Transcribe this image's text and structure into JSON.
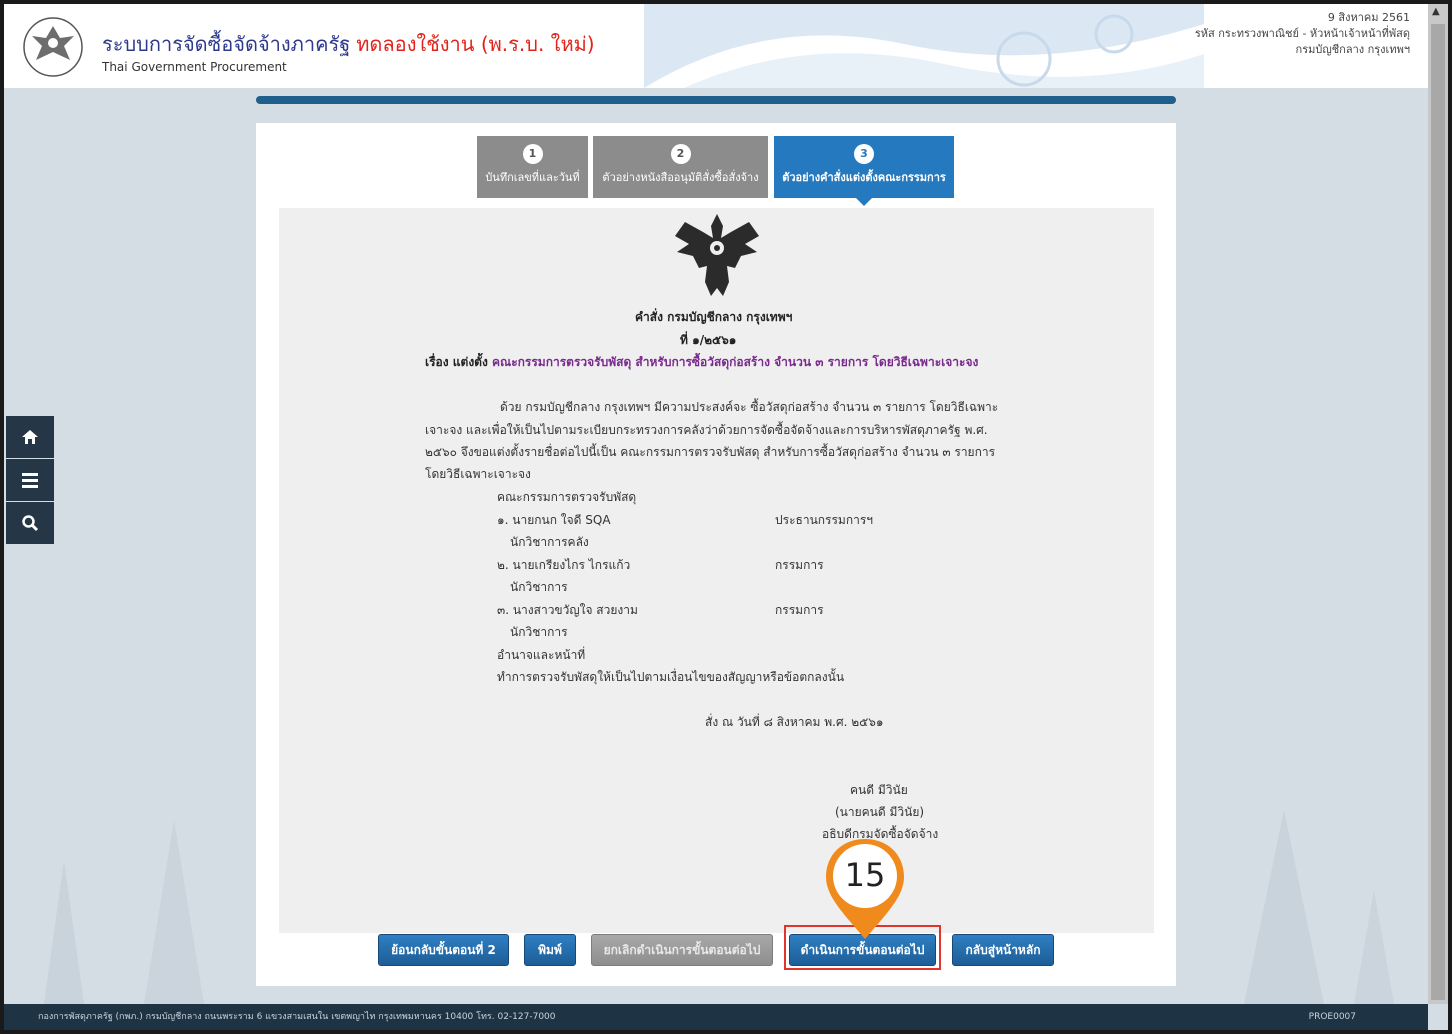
{
  "header": {
    "title": "ระบบการจัดซื้อจัดจ้างภาครัฐ",
    "trial": "ทดลองใช้งาน (พ.ร.บ. ใหม่)",
    "subtitle": "Thai Government Procurement",
    "date": "9 สิงหาคม 2561",
    "user_line": "รหัส กระทรวงพาณิชย์ - หัวหน้าเจ้าหน้าที่พัสดุ",
    "org": "กรมบัญชีกลาง กรุงเทพฯ"
  },
  "steps": [
    {
      "num": "1",
      "label": "บันทึกเลขที่และวันที่"
    },
    {
      "num": "2",
      "label": "ตัวอย่างหนังสืออนุมัติสั่งซื้อสั่งจ้าง"
    },
    {
      "num": "3",
      "label": "ตัวอย่างคำสั่งแต่งตั้งคณะกรรมการ"
    }
  ],
  "document": {
    "order_line": "คำสั่ง กรมบัญชีกลาง กรุงเทพฯ",
    "number_line": "ที่  ๑/๒๕๖๑",
    "subject_prefix": "เรื่อง แต่งตั้ง",
    "subject": "คณะกรรมการตรวจรับพัสดุ สำหรับการซื้อวัสดุก่อสร้าง จำนวน ๓ รายการ โดยวิธีเฉพาะเจาะจง",
    "body_1": "ด้วย กรมบัญชีกลาง กรุงเทพฯ มีความประสงค์จะ ซื้อวัสดุก่อสร้าง จำนวน ๓ รายการ โดยวิธีเฉพาะ",
    "body_2": "เจาะจง  และเพื่อให้เป็นไปตามระเบียบกระทรวงการคลังว่าด้วยการจัดซื้อจัดจ้างและการบริหารพัสดุภาครัฐ พ.ศ.",
    "body_3": "๒๕๖๐ จึงขอแต่งตั้งรายชื่อต่อไปนี้เป็น คณะกรรมการตรวจรับพัสดุ สำหรับการซื้อวัสดุก่อสร้าง จำนวน ๓ รายการ",
    "body_4": "โดยวิธีเฉพาะเจาะจง",
    "committee_heading": "คณะกรรมการตรวจรับพัสดุ",
    "members": [
      {
        "name": "๑. นายกนก ใจดี SQA",
        "position": "นักวิชาการคลัง",
        "role": "ประธานกรรมการฯ"
      },
      {
        "name": "๒. นายเกรียงไกร ไกรแก้ว",
        "position": "นักวิชาการ",
        "role": "กรรมการ"
      },
      {
        "name": "๓. นางสาวขวัญใจ สวยงาม",
        "position": "นักวิชาการ",
        "role": "กรรมการ"
      }
    ],
    "duty_heading": "อำนาจและหน้าที่",
    "duty_text": "ทำการตรวจรับพัสดุให้เป็นไปตามเงื่อนไขของสัญญาหรือข้อตกลงนั้น",
    "order_date": "สั่ง ณ วันที่  ๘ สิงหาคม พ.ศ. ๒๕๖๑",
    "signer": "คนดี มีวินัย",
    "signer_paren": "(นายคนดี มีวินัย)",
    "signer_title": "อธิบดีกรมจัดซื้อจัดจ้าง"
  },
  "buttons": {
    "back": "ย้อนกลับขั้นตอนที่ 2",
    "print": "พิมพ์",
    "cancel_next": "ยกเลิกดำเนินการขั้นตอนต่อไป",
    "next": "ดำเนินการขั้นตอนต่อไป",
    "home": "กลับสู่หน้าหลัก"
  },
  "annotation": {
    "marker": "15",
    "color": "#f08a1c"
  },
  "footer": {
    "address": "กองการพัสดุภาครัฐ (กพภ.) กรมบัญชีกลาง ถนนพระราม 6 แขวงสามเสนใน เขตพญาไท กรุงเทพมหานคร 10400 โทร. 02-127-7000",
    "code": "PROE0007"
  },
  "sidebar": {
    "icons": [
      "home-icon",
      "menu-icon",
      "search-icon"
    ]
  },
  "colors": {
    "accent": "#2579bf",
    "trial_text": "#e2231a",
    "highlight": "#e0342c",
    "footer_bg": "#1e3344"
  }
}
